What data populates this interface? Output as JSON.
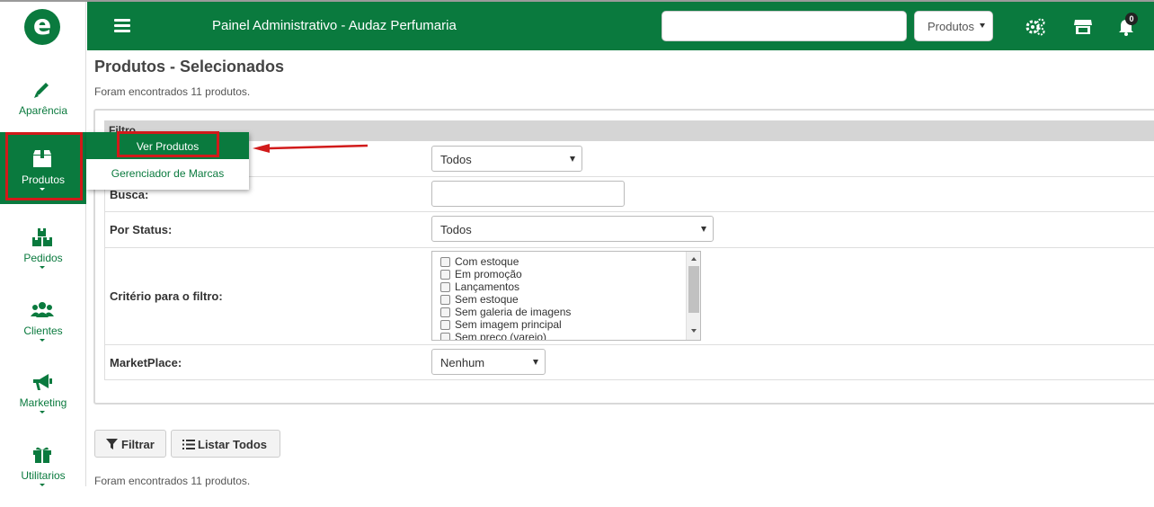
{
  "header": {
    "title": "Painel Administrativo - Audaz Perfumaria",
    "search_value": "",
    "scope_select": "Produtos",
    "notifications_count": "0"
  },
  "logo": {
    "letter": "e"
  },
  "sidebar": {
    "items": [
      {
        "label": "Aparência",
        "icon": "pencil-icon"
      },
      {
        "label": "Produtos",
        "icon": "box-icon"
      },
      {
        "label": "Pedidos",
        "icon": "boxes-icon"
      },
      {
        "label": "Clientes",
        "icon": "users-icon"
      },
      {
        "label": "Marketing",
        "icon": "megaphone-icon"
      },
      {
        "label": "Utilitarios",
        "icon": "gift-icon"
      }
    ]
  },
  "products_menu": {
    "items": [
      "Ver Produtos",
      "Gerenciador de Marcas"
    ]
  },
  "main": {
    "title": "Produtos - Selecionados",
    "count_text": "Foram encontrados 11 produtos.",
    "filter_header": "Filtro",
    "category_select": "Todos",
    "search_label": "Busca:",
    "search_value": "",
    "status_label": "Por Status:",
    "status_select": "Todos",
    "criteria_label": "Critério para o filtro:",
    "criteria_options": [
      "Com estoque",
      "Em promoção",
      "Lançamentos",
      "Sem estoque",
      "Sem galeria de imagens",
      "Sem imagem principal",
      "Sem preço (varejo)"
    ],
    "marketplace_label": "MarketPlace:",
    "marketplace_select": "Nenhum",
    "filter_button": "Filtrar",
    "list_all_button": "Listar Todos"
  },
  "colors": {
    "brand": "#0a7a3e",
    "highlight": "#d11a1a"
  }
}
